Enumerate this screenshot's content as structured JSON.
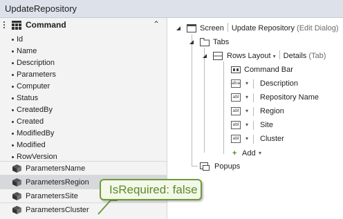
{
  "window": {
    "title": "UpdateRepository"
  },
  "left_panel": {
    "entity_name": "Command",
    "properties": [
      "Id",
      "Name",
      "Description",
      "Parameters",
      "Computer",
      "Status",
      "CreatedBy",
      "Created",
      "ModifiedBy",
      "Modified",
      "RowVersion"
    ],
    "navigation": [
      "ParametersName",
      "ParametersRegion",
      "ParametersSite",
      "ParametersCluster"
    ],
    "selected_navigation": "ParametersRegion"
  },
  "tree": {
    "screen": {
      "label": "Screen",
      "name": "Update Repository",
      "kind": "(Edit Dialog)"
    },
    "tabs": {
      "label": "Tabs"
    },
    "rows_layout": {
      "label": "Rows Layout",
      "name": "Details",
      "kind": "(Tab)"
    },
    "command_bar": {
      "label": "Command Bar"
    },
    "fields": [
      {
        "label": "Description",
        "icon": "multiline-text-icon"
      },
      {
        "label": "Repository Name",
        "icon": "textbox-icon"
      },
      {
        "label": "Region",
        "icon": "textbox-icon"
      },
      {
        "label": "Site",
        "icon": "textbox-icon"
      },
      {
        "label": "Cluster",
        "icon": "textbox-icon"
      }
    ],
    "add": {
      "label": "Add"
    },
    "popups": {
      "label": "Popups"
    }
  },
  "tooltip": {
    "text": "IsRequired: false"
  },
  "colors": {
    "accent_green": "#6e9a3c",
    "tooltip_text": "#5b8a2a",
    "selection": "#d6d8dc",
    "titlebar": "#dde1ea"
  }
}
